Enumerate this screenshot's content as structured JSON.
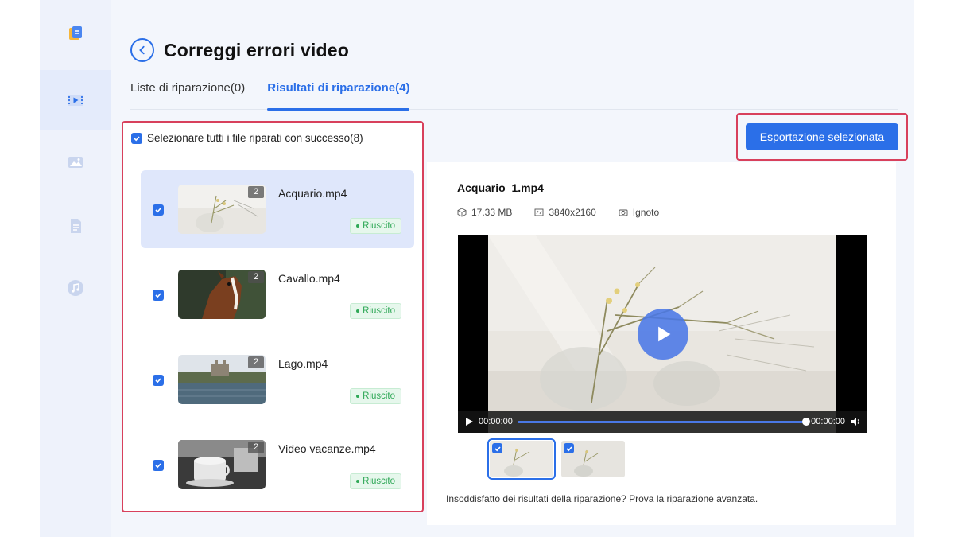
{
  "header": {
    "title": "Correggi errori video"
  },
  "tabs": [
    {
      "label": "Liste di riparazione(0)",
      "active": false
    },
    {
      "label": "Risultati di riparazione(4)",
      "active": true
    }
  ],
  "list": {
    "select_all_label": "Selezionare tutti i file riparati con successo(8)",
    "files": [
      {
        "name": "Acquario.mp4",
        "count": "2",
        "status": "Riuscito",
        "selected": true
      },
      {
        "name": "Cavallo.mp4",
        "count": "2",
        "status": "Riuscito",
        "selected": false
      },
      {
        "name": "Lago.mp4",
        "count": "2",
        "status": "Riuscito",
        "selected": false
      },
      {
        "name": "Video vacanze.mp4",
        "count": "2",
        "status": "Riuscito",
        "selected": false
      }
    ]
  },
  "toolbar": {
    "export_label": "Esportazione selezionata"
  },
  "preview": {
    "file_name": "Acquario_1.mp4",
    "size": "17.33 MB",
    "resolution": "3840x2160",
    "device": "Ignoto",
    "time_current": "00:00:00",
    "time_total": "00:00:00",
    "progress": 1.0,
    "hint": "Insoddisfatto dei risultati della riparazione? Prova la riparazione avanzata."
  },
  "colors": {
    "accent": "#2b6fe8",
    "highlight_border": "#d8405c",
    "success": "#2fa857"
  }
}
